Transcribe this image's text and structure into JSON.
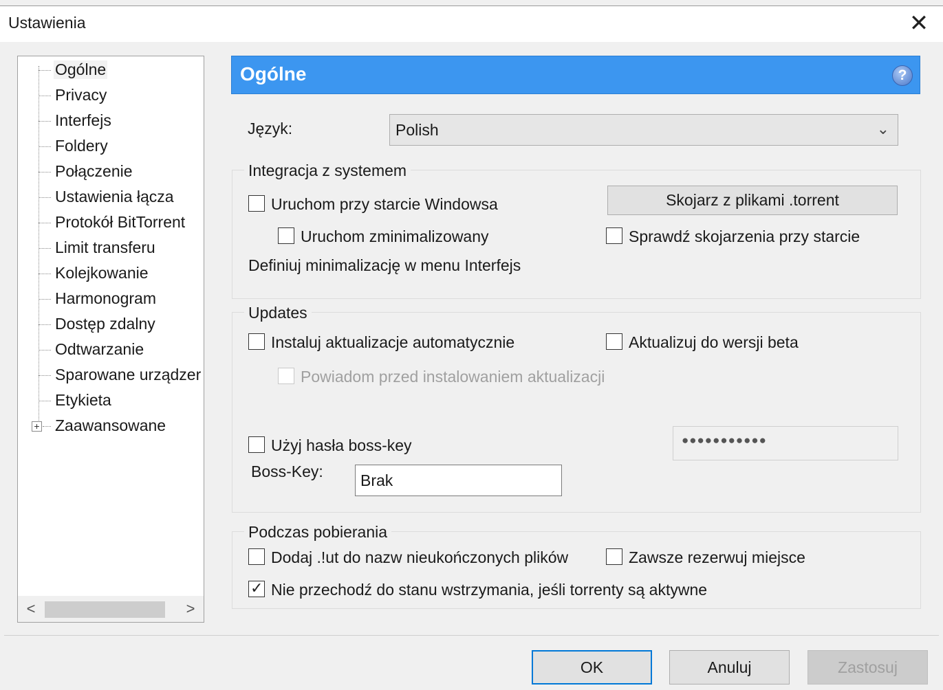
{
  "window": {
    "title": "Ustawienia",
    "close_glyph": "✕"
  },
  "tree": {
    "items": [
      "Ogólne",
      "Privacy",
      "Interfejs",
      "Foldery",
      "Połączenie",
      "Ustawienia łącza",
      "Protokół BitTorrent",
      "Limit transferu",
      "Kolejkowanie",
      "Harmonogram",
      "Dostęp zdalny",
      "Odtwarzanie",
      "Sparowane urządzer",
      "Etykieta",
      "Zaawansowane"
    ],
    "selected": "Ogólne",
    "expander": "+",
    "scroll_left": "<",
    "scroll_right": ">"
  },
  "header": {
    "title": "Ogólne",
    "help": "?",
    "color": "#3c96f0"
  },
  "language": {
    "label": "Język:",
    "value": "Polish"
  },
  "integration": {
    "title": "Integracja z systemem",
    "start_windows": "Uruchom przy starcie Windowsa",
    "start_minimized": "Uruchom zminimalizowany",
    "define_min": "Definiuj minimalizację w menu Interfejs",
    "associate_button": "Skojarz z plikami .torrent",
    "check_assoc": "Sprawdź skojarzenia przy starcie"
  },
  "updates": {
    "title": "Updates",
    "auto_install": "Instaluj aktualizacje automatycznie",
    "beta": "Aktualizuj do wersji beta",
    "notify": "Powiadom przed instalowaniem aktualizacji",
    "bosskey_pwd": "Użyj hasła boss-key",
    "password_mask": "●●●●●●●●●●●",
    "bosskey_label": "Boss-Key:",
    "bosskey_value": "Brak"
  },
  "download": {
    "title": "Podczas pobierania",
    "add_ut": "Dodaj .!ut do nazw nieukończonych plików",
    "reserve": "Zawsze rezerwuj miejsce",
    "no_standby": "Nie przechodź do stanu wstrzymania, jeśli torrenty są aktywne"
  },
  "buttons": {
    "ok": "OK",
    "cancel": "Anuluj",
    "apply": "Zastosuj"
  }
}
